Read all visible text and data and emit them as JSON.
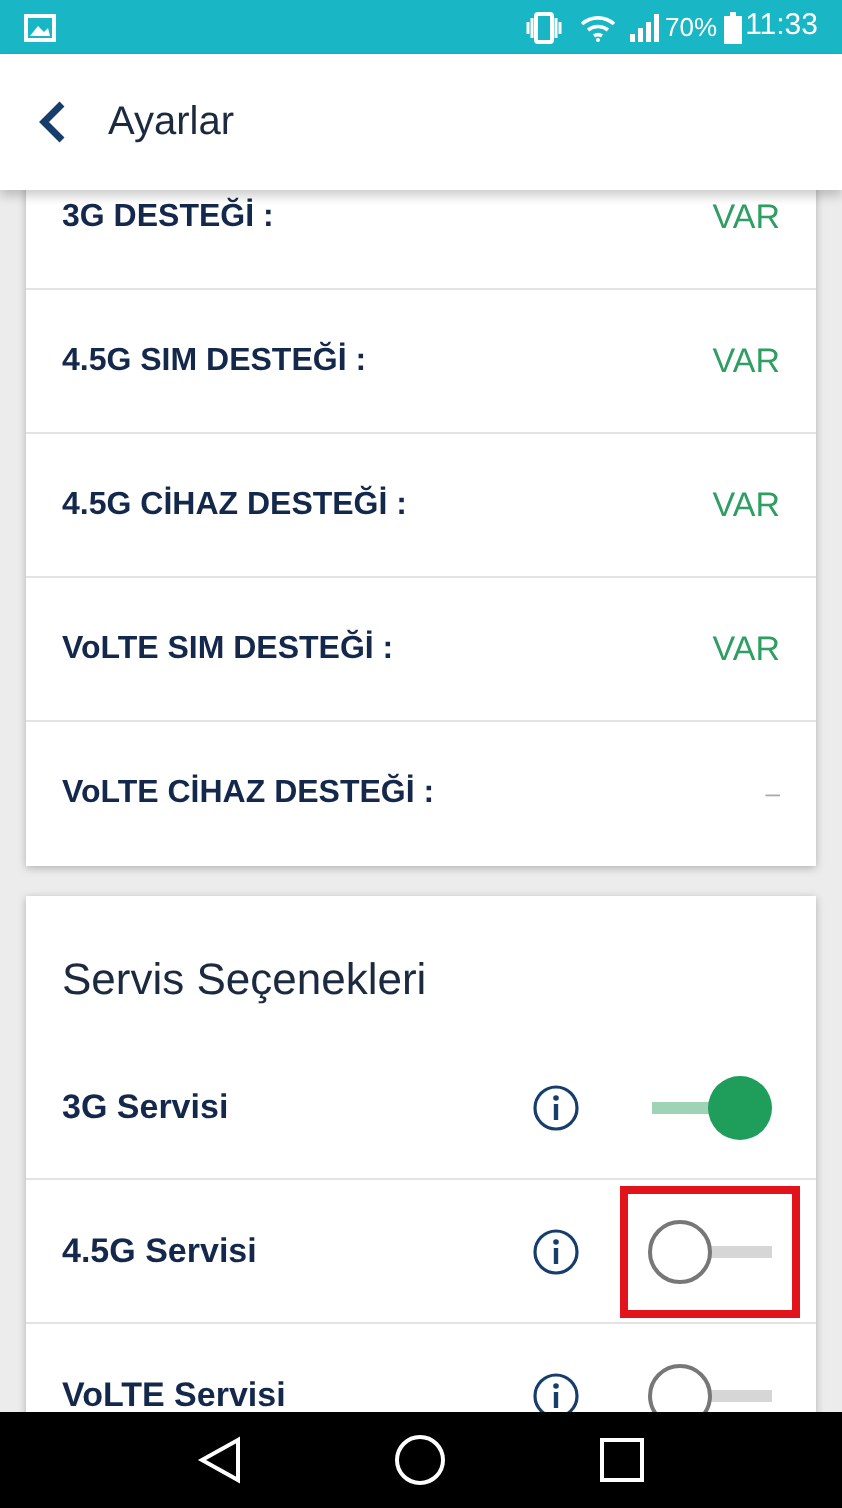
{
  "status_bar": {
    "battery": "70%",
    "time": "11:33"
  },
  "header": {
    "title": "Ayarlar"
  },
  "support_list": [
    {
      "label": "3G DESTEĞİ :",
      "value": "VAR",
      "available": true
    },
    {
      "label": "4.5G SIM DESTEĞİ :",
      "value": "VAR",
      "available": true
    },
    {
      "label": "4.5G CİHAZ DESTEĞİ :",
      "value": "VAR",
      "available": true
    },
    {
      "label": "VoLTE SIM DESTEĞİ :",
      "value": "VAR",
      "available": true
    },
    {
      "label": "VoLTE CİHAZ DESTEĞİ :",
      "value": "–",
      "available": false
    }
  ],
  "service_options": {
    "title": "Servis Seçenekleri",
    "items": [
      {
        "label": "3G Servisi",
        "on": true,
        "highlighted": false
      },
      {
        "label": "4.5G Servisi",
        "on": false,
        "highlighted": true
      },
      {
        "label": "VoLTE Servisi",
        "on": false,
        "highlighted": false
      }
    ]
  }
}
